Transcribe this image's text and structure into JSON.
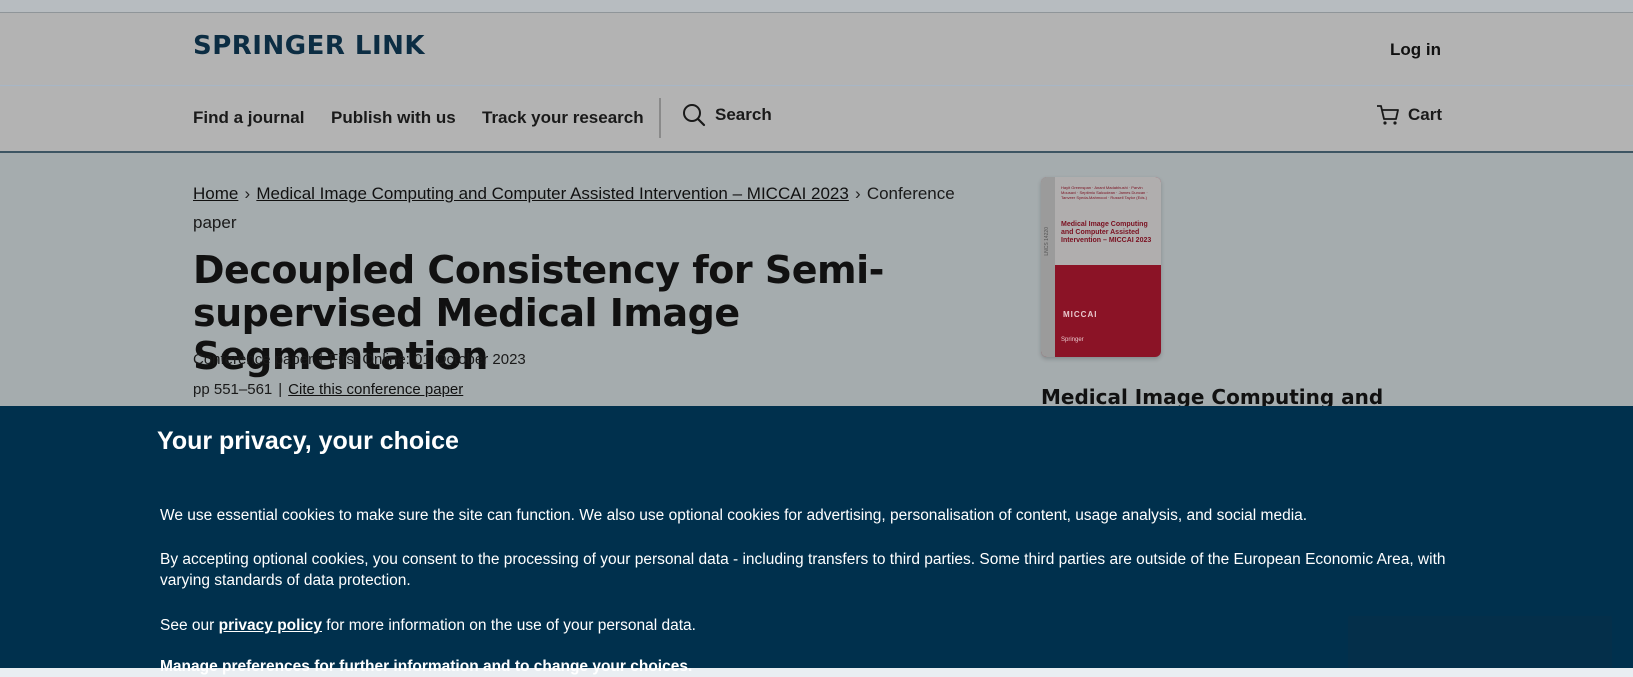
{
  "header": {
    "logo": "SPRINGER LINK",
    "login": "Log in"
  },
  "nav": {
    "items": [
      "Find a journal",
      "Publish with us",
      "Track your research"
    ],
    "search": "Search",
    "cart": "Cart"
  },
  "breadcrumb": {
    "home": "Home",
    "book": "Medical Image Computing and Computer Assisted Intervention – MICCAI 2023",
    "current": "Conference paper"
  },
  "article": {
    "title": "Decoupled Consistency for Semi-supervised Medical Image Segmentation",
    "type": "Conference paper",
    "first_online": "First Online: 01 October 2023",
    "pages": "pp 551–561",
    "cite": "Cite this conference paper"
  },
  "sidebar": {
    "cover_authors": "Hayit Greenspan · Anant Madabhushi · Parvin Mousavi · Septimiu Salcudean · James Duncan · Tanveer Syeda-Mahmood · Russell Taylor (Eds.)",
    "cover_title": "Medical Image Computing and Computer Assisted Intervention – MICCAI 2023",
    "cover_series": "LNCS 14220",
    "cover_miccai": "MICCAI",
    "cover_publisher": "Springer",
    "book_title": "Medical Image Computing and"
  },
  "cookie_banner": {
    "heading": "Your privacy, your choice",
    "para1": "We use essential cookies to make sure the site can function. We also use optional cookies for advertising, personalisation of content, usage analysis, and social media.",
    "para2": "By accepting optional cookies, you consent to the processing of your personal data - including transfers to third parties. Some third parties are outside of the European Economic Area, with varying standards of data protection.",
    "para3_before": "See our ",
    "para3_link": "privacy policy",
    "para3_after": " for more information on the use of your personal data.",
    "para4": "Manage preferences for further information and to change your choices."
  },
  "colors": {
    "banner_bg": "#00304d",
    "cover_red": "#8b1326",
    "logo": "#0c2d43"
  }
}
